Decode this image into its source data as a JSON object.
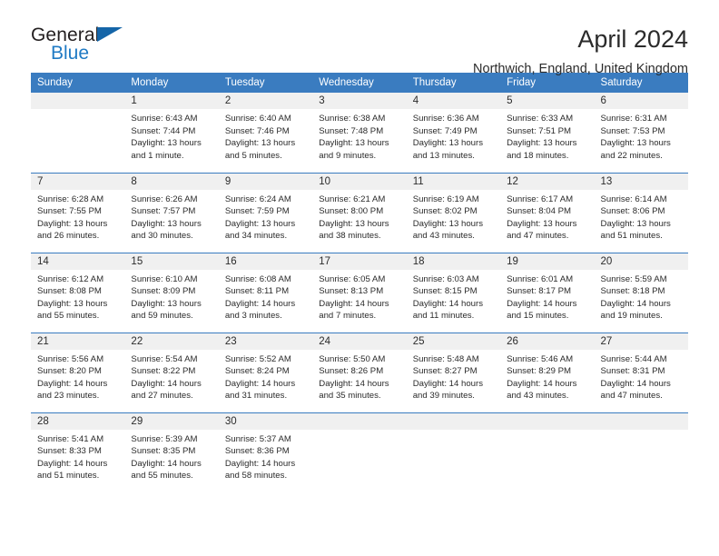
{
  "brand": {
    "name_top": "General",
    "name_bottom": "Blue",
    "triangle_color": "#1565a8",
    "blue_text_color": "#1f7ac4"
  },
  "header": {
    "title": "April 2024",
    "subtitle": "Northwich, England, United Kingdom",
    "header_bg": "#3a7cc0",
    "daynum_bg": "#f0f0f0"
  },
  "weekdays": [
    "Sunday",
    "Monday",
    "Tuesday",
    "Wednesday",
    "Thursday",
    "Friday",
    "Saturday"
  ],
  "labels": {
    "sunrise_prefix": "Sunrise:",
    "sunset_prefix": "Sunset:",
    "daylight_prefix": "Daylight:"
  },
  "weeks": [
    [
      {
        "day": "",
        "empty": true
      },
      {
        "day": "1",
        "sunrise": "Sunrise: 6:43 AM",
        "sunset": "Sunset: 7:44 PM",
        "daylight_line1": "Daylight: 13 hours",
        "daylight_line2": "and 1 minute."
      },
      {
        "day": "2",
        "sunrise": "Sunrise: 6:40 AM",
        "sunset": "Sunset: 7:46 PM",
        "daylight_line1": "Daylight: 13 hours",
        "daylight_line2": "and 5 minutes."
      },
      {
        "day": "3",
        "sunrise": "Sunrise: 6:38 AM",
        "sunset": "Sunset: 7:48 PM",
        "daylight_line1": "Daylight: 13 hours",
        "daylight_line2": "and 9 minutes."
      },
      {
        "day": "4",
        "sunrise": "Sunrise: 6:36 AM",
        "sunset": "Sunset: 7:49 PM",
        "daylight_line1": "Daylight: 13 hours",
        "daylight_line2": "and 13 minutes."
      },
      {
        "day": "5",
        "sunrise": "Sunrise: 6:33 AM",
        "sunset": "Sunset: 7:51 PM",
        "daylight_line1": "Daylight: 13 hours",
        "daylight_line2": "and 18 minutes."
      },
      {
        "day": "6",
        "sunrise": "Sunrise: 6:31 AM",
        "sunset": "Sunset: 7:53 PM",
        "daylight_line1": "Daylight: 13 hours",
        "daylight_line2": "and 22 minutes."
      }
    ],
    [
      {
        "day": "7",
        "sunrise": "Sunrise: 6:28 AM",
        "sunset": "Sunset: 7:55 PM",
        "daylight_line1": "Daylight: 13 hours",
        "daylight_line2": "and 26 minutes."
      },
      {
        "day": "8",
        "sunrise": "Sunrise: 6:26 AM",
        "sunset": "Sunset: 7:57 PM",
        "daylight_line1": "Daylight: 13 hours",
        "daylight_line2": "and 30 minutes."
      },
      {
        "day": "9",
        "sunrise": "Sunrise: 6:24 AM",
        "sunset": "Sunset: 7:59 PM",
        "daylight_line1": "Daylight: 13 hours",
        "daylight_line2": "and 34 minutes."
      },
      {
        "day": "10",
        "sunrise": "Sunrise: 6:21 AM",
        "sunset": "Sunset: 8:00 PM",
        "daylight_line1": "Daylight: 13 hours",
        "daylight_line2": "and 38 minutes."
      },
      {
        "day": "11",
        "sunrise": "Sunrise: 6:19 AM",
        "sunset": "Sunset: 8:02 PM",
        "daylight_line1": "Daylight: 13 hours",
        "daylight_line2": "and 43 minutes."
      },
      {
        "day": "12",
        "sunrise": "Sunrise: 6:17 AM",
        "sunset": "Sunset: 8:04 PM",
        "daylight_line1": "Daylight: 13 hours",
        "daylight_line2": "and 47 minutes."
      },
      {
        "day": "13",
        "sunrise": "Sunrise: 6:14 AM",
        "sunset": "Sunset: 8:06 PM",
        "daylight_line1": "Daylight: 13 hours",
        "daylight_line2": "and 51 minutes."
      }
    ],
    [
      {
        "day": "14",
        "sunrise": "Sunrise: 6:12 AM",
        "sunset": "Sunset: 8:08 PM",
        "daylight_line1": "Daylight: 13 hours",
        "daylight_line2": "and 55 minutes."
      },
      {
        "day": "15",
        "sunrise": "Sunrise: 6:10 AM",
        "sunset": "Sunset: 8:09 PM",
        "daylight_line1": "Daylight: 13 hours",
        "daylight_line2": "and 59 minutes."
      },
      {
        "day": "16",
        "sunrise": "Sunrise: 6:08 AM",
        "sunset": "Sunset: 8:11 PM",
        "daylight_line1": "Daylight: 14 hours",
        "daylight_line2": "and 3 minutes."
      },
      {
        "day": "17",
        "sunrise": "Sunrise: 6:05 AM",
        "sunset": "Sunset: 8:13 PM",
        "daylight_line1": "Daylight: 14 hours",
        "daylight_line2": "and 7 minutes."
      },
      {
        "day": "18",
        "sunrise": "Sunrise: 6:03 AM",
        "sunset": "Sunset: 8:15 PM",
        "daylight_line1": "Daylight: 14 hours",
        "daylight_line2": "and 11 minutes."
      },
      {
        "day": "19",
        "sunrise": "Sunrise: 6:01 AM",
        "sunset": "Sunset: 8:17 PM",
        "daylight_line1": "Daylight: 14 hours",
        "daylight_line2": "and 15 minutes."
      },
      {
        "day": "20",
        "sunrise": "Sunrise: 5:59 AM",
        "sunset": "Sunset: 8:18 PM",
        "daylight_line1": "Daylight: 14 hours",
        "daylight_line2": "and 19 minutes."
      }
    ],
    [
      {
        "day": "21",
        "sunrise": "Sunrise: 5:56 AM",
        "sunset": "Sunset: 8:20 PM",
        "daylight_line1": "Daylight: 14 hours",
        "daylight_line2": "and 23 minutes."
      },
      {
        "day": "22",
        "sunrise": "Sunrise: 5:54 AM",
        "sunset": "Sunset: 8:22 PM",
        "daylight_line1": "Daylight: 14 hours",
        "daylight_line2": "and 27 minutes."
      },
      {
        "day": "23",
        "sunrise": "Sunrise: 5:52 AM",
        "sunset": "Sunset: 8:24 PM",
        "daylight_line1": "Daylight: 14 hours",
        "daylight_line2": "and 31 minutes."
      },
      {
        "day": "24",
        "sunrise": "Sunrise: 5:50 AM",
        "sunset": "Sunset: 8:26 PM",
        "daylight_line1": "Daylight: 14 hours",
        "daylight_line2": "and 35 minutes."
      },
      {
        "day": "25",
        "sunrise": "Sunrise: 5:48 AM",
        "sunset": "Sunset: 8:27 PM",
        "daylight_line1": "Daylight: 14 hours",
        "daylight_line2": "and 39 minutes."
      },
      {
        "day": "26",
        "sunrise": "Sunrise: 5:46 AM",
        "sunset": "Sunset: 8:29 PM",
        "daylight_line1": "Daylight: 14 hours",
        "daylight_line2": "and 43 minutes."
      },
      {
        "day": "27",
        "sunrise": "Sunrise: 5:44 AM",
        "sunset": "Sunset: 8:31 PM",
        "daylight_line1": "Daylight: 14 hours",
        "daylight_line2": "and 47 minutes."
      }
    ],
    [
      {
        "day": "28",
        "sunrise": "Sunrise: 5:41 AM",
        "sunset": "Sunset: 8:33 PM",
        "daylight_line1": "Daylight: 14 hours",
        "daylight_line2": "and 51 minutes."
      },
      {
        "day": "29",
        "sunrise": "Sunrise: 5:39 AM",
        "sunset": "Sunset: 8:35 PM",
        "daylight_line1": "Daylight: 14 hours",
        "daylight_line2": "and 55 minutes."
      },
      {
        "day": "30",
        "sunrise": "Sunrise: 5:37 AM",
        "sunset": "Sunset: 8:36 PM",
        "daylight_line1": "Daylight: 14 hours",
        "daylight_line2": "and 58 minutes."
      },
      {
        "day": "",
        "empty": true
      },
      {
        "day": "",
        "empty": true
      },
      {
        "day": "",
        "empty": true
      },
      {
        "day": "",
        "empty": true
      }
    ]
  ]
}
